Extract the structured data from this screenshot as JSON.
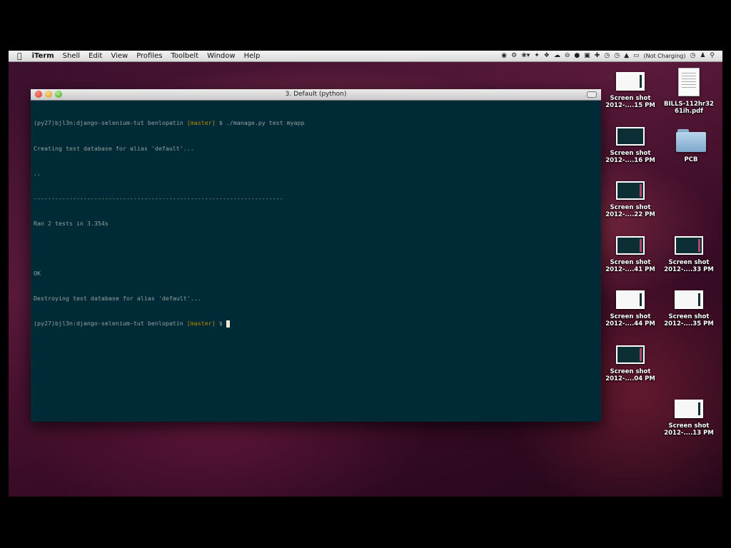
{
  "menubar": {
    "app_name": "iTerm",
    "menus": [
      "Shell",
      "Edit",
      "View",
      "Profiles",
      "Toolbelt",
      "Window",
      "Help"
    ],
    "status": {
      "battery_text": "(Not Charging)"
    }
  },
  "terminal": {
    "window_title": "3. Default (python)",
    "prompt_prefix": "(py27)bjl3n:django-selenium-tut benlopatin ",
    "branch": "[master]",
    "prompt_symbol": " $ ",
    "command": "./manage.py test myapp",
    "output": [
      "Creating test database for alias 'default'...",
      "..",
      "----------------------------------------------------------------------",
      "Ran 2 tests in 3.354s",
      "",
      "OK",
      "Destroying test database for alias 'default'..."
    ]
  },
  "desktop": {
    "icons": [
      {
        "label1": "Screen shot",
        "label2": "2012-....15 PM"
      },
      {
        "label1": "BILLS-112hr32",
        "label2": "61ih.pdf"
      },
      {
        "label1": "Screen shot",
        "label2": "2012-....16 PM"
      },
      {
        "label1": "PCB",
        "label2": ""
      },
      {
        "label1": "Screen shot",
        "label2": "2012-....22 PM"
      },
      {
        "label1": "Screen shot",
        "label2": "2012-....41 PM"
      },
      {
        "label1": "Screen shot",
        "label2": "2012-....33 PM"
      },
      {
        "label1": "Screen shot",
        "label2": "2012-....44 PM"
      },
      {
        "label1": "Screen shot",
        "label2": "2012-....35 PM"
      },
      {
        "label1": "Screen shot",
        "label2": "2012-....04 PM"
      },
      {
        "label1": "Screen shot",
        "label2": "2012-....13 PM"
      }
    ]
  }
}
